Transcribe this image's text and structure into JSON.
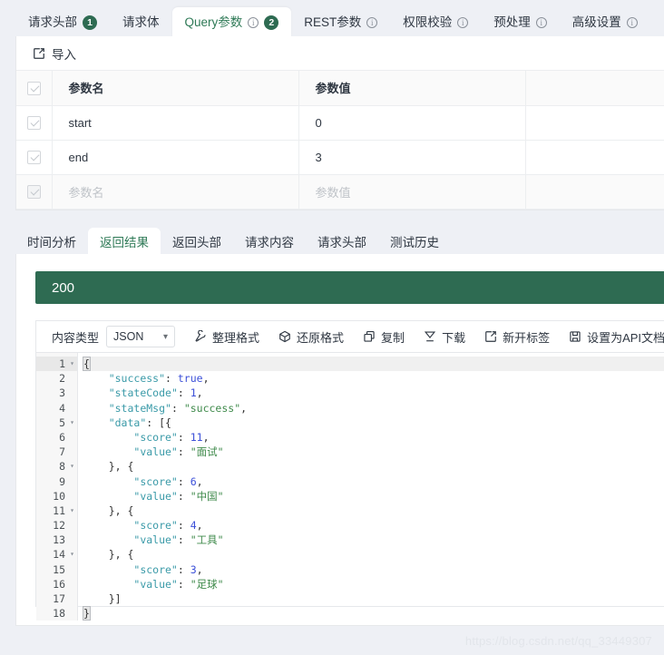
{
  "request_tabs": [
    {
      "label": "请求头部",
      "info": false,
      "badge": "1",
      "active": false
    },
    {
      "label": "请求体",
      "info": false,
      "badge": "",
      "active": false
    },
    {
      "label": "Query参数",
      "info": true,
      "badge": "2",
      "active": true
    },
    {
      "label": "REST参数",
      "info": true,
      "badge": "",
      "active": false
    },
    {
      "label": "权限校验",
      "info": true,
      "badge": "",
      "active": false
    },
    {
      "label": "预处理",
      "info": true,
      "badge": "",
      "active": false
    },
    {
      "label": "高级设置",
      "info": true,
      "badge": "",
      "active": false
    }
  ],
  "import": {
    "label": "导入",
    "icon": "export-icon"
  },
  "params_table": {
    "headers": [
      "参数名",
      "参数值"
    ],
    "rows": [
      {
        "checked": true,
        "name": "start",
        "value": "0",
        "placeholder": false
      },
      {
        "checked": true,
        "name": "end",
        "value": "3",
        "placeholder": false
      },
      {
        "checked": true,
        "name": "参数名",
        "value": "参数值",
        "placeholder": true
      }
    ]
  },
  "response_tabs": [
    {
      "label": "时间分析",
      "active": false
    },
    {
      "label": "返回结果",
      "active": true
    },
    {
      "label": "返回头部",
      "active": false
    },
    {
      "label": "请求内容",
      "active": false
    },
    {
      "label": "请求头部",
      "active": false
    },
    {
      "label": "测试历史",
      "active": false
    }
  ],
  "status": {
    "code": "200",
    "color": "#2e6b52"
  },
  "editor_toolbar": {
    "content_type_label": "内容类型",
    "content_type_value": "JSON",
    "content_type_options": [
      "JSON"
    ],
    "actions": [
      {
        "label": "整理格式",
        "icon": "magic-wand-icon"
      },
      {
        "label": "还原格式",
        "icon": "cube-icon"
      },
      {
        "label": "复制",
        "icon": "copy-icon"
      },
      {
        "label": "下载",
        "icon": "download-icon"
      },
      {
        "label": "新开标签",
        "icon": "external-link-icon"
      },
      {
        "label": "设置为API文档返",
        "icon": "save-doc-icon"
      }
    ]
  },
  "code": {
    "language": "json",
    "active_line": 1,
    "lines": [
      {
        "n": "1",
        "fold": true,
        "tokens": [
          {
            "t": "{",
            "c": "p brk"
          }
        ]
      },
      {
        "n": "2",
        "fold": false,
        "tokens": [
          {
            "t": "    ",
            "c": "p"
          },
          {
            "t": "\"success\"",
            "c": "k"
          },
          {
            "t": ": ",
            "c": "p"
          },
          {
            "t": "true",
            "c": "n"
          },
          {
            "t": ",",
            "c": "p"
          }
        ]
      },
      {
        "n": "3",
        "fold": false,
        "tokens": [
          {
            "t": "    ",
            "c": "p"
          },
          {
            "t": "\"stateCode\"",
            "c": "k"
          },
          {
            "t": ": ",
            "c": "p"
          },
          {
            "t": "1",
            "c": "n"
          },
          {
            "t": ",",
            "c": "p"
          }
        ]
      },
      {
        "n": "4",
        "fold": false,
        "tokens": [
          {
            "t": "    ",
            "c": "p"
          },
          {
            "t": "\"stateMsg\"",
            "c": "k"
          },
          {
            "t": ": ",
            "c": "p"
          },
          {
            "t": "\"success\"",
            "c": "s"
          },
          {
            "t": ",",
            "c": "p"
          }
        ]
      },
      {
        "n": "5",
        "fold": true,
        "tokens": [
          {
            "t": "    ",
            "c": "p"
          },
          {
            "t": "\"data\"",
            "c": "k"
          },
          {
            "t": ": [{",
            "c": "p"
          }
        ]
      },
      {
        "n": "6",
        "fold": false,
        "tokens": [
          {
            "t": "        ",
            "c": "p"
          },
          {
            "t": "\"score\"",
            "c": "k"
          },
          {
            "t": ": ",
            "c": "p"
          },
          {
            "t": "11",
            "c": "n"
          },
          {
            "t": ",",
            "c": "p"
          }
        ]
      },
      {
        "n": "7",
        "fold": false,
        "tokens": [
          {
            "t": "        ",
            "c": "p"
          },
          {
            "t": "\"value\"",
            "c": "k"
          },
          {
            "t": ": ",
            "c": "p"
          },
          {
            "t": "\"面试\"",
            "c": "s"
          }
        ]
      },
      {
        "n": "8",
        "fold": true,
        "tokens": [
          {
            "t": "    }, {",
            "c": "p"
          }
        ]
      },
      {
        "n": "9",
        "fold": false,
        "tokens": [
          {
            "t": "        ",
            "c": "p"
          },
          {
            "t": "\"score\"",
            "c": "k"
          },
          {
            "t": ": ",
            "c": "p"
          },
          {
            "t": "6",
            "c": "n"
          },
          {
            "t": ",",
            "c": "p"
          }
        ]
      },
      {
        "n": "10",
        "fold": false,
        "tokens": [
          {
            "t": "        ",
            "c": "p"
          },
          {
            "t": "\"value\"",
            "c": "k"
          },
          {
            "t": ": ",
            "c": "p"
          },
          {
            "t": "\"中国\"",
            "c": "s"
          }
        ]
      },
      {
        "n": "11",
        "fold": true,
        "tokens": [
          {
            "t": "    }, {",
            "c": "p"
          }
        ]
      },
      {
        "n": "12",
        "fold": false,
        "tokens": [
          {
            "t": "        ",
            "c": "p"
          },
          {
            "t": "\"score\"",
            "c": "k"
          },
          {
            "t": ": ",
            "c": "p"
          },
          {
            "t": "4",
            "c": "n"
          },
          {
            "t": ",",
            "c": "p"
          }
        ]
      },
      {
        "n": "13",
        "fold": false,
        "tokens": [
          {
            "t": "        ",
            "c": "p"
          },
          {
            "t": "\"value\"",
            "c": "k"
          },
          {
            "t": ": ",
            "c": "p"
          },
          {
            "t": "\"工具\"",
            "c": "s"
          }
        ]
      },
      {
        "n": "14",
        "fold": true,
        "tokens": [
          {
            "t": "    }, {",
            "c": "p"
          }
        ]
      },
      {
        "n": "15",
        "fold": false,
        "tokens": [
          {
            "t": "        ",
            "c": "p"
          },
          {
            "t": "\"score\"",
            "c": "k"
          },
          {
            "t": ": ",
            "c": "p"
          },
          {
            "t": "3",
            "c": "n"
          },
          {
            "t": ",",
            "c": "p"
          }
        ]
      },
      {
        "n": "16",
        "fold": false,
        "tokens": [
          {
            "t": "        ",
            "c": "p"
          },
          {
            "t": "\"value\"",
            "c": "k"
          },
          {
            "t": ": ",
            "c": "p"
          },
          {
            "t": "\"足球\"",
            "c": "s"
          }
        ]
      },
      {
        "n": "17",
        "fold": false,
        "tokens": [
          {
            "t": "    }]",
            "c": "p"
          }
        ]
      },
      {
        "n": "18",
        "fold": false,
        "tokens": [
          {
            "t": "}",
            "c": "p brk"
          }
        ]
      }
    ]
  },
  "watermark": "https://blog.csdn.net/qq_33449307"
}
